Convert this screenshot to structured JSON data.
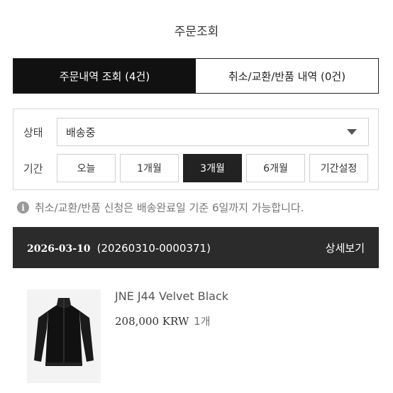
{
  "header": {
    "title": "주문조회"
  },
  "tabs": [
    {
      "label": "주문내역 조회 (4건)",
      "active": true
    },
    {
      "label": "취소/교환/반품 내역 (0건)",
      "active": false
    }
  ],
  "filter": {
    "status_label": "상태",
    "status_value": "배송중",
    "period_label": "기간",
    "periods": [
      "오늘",
      "1개월",
      "3개월",
      "6개월",
      "기간설정"
    ],
    "active_period": "3개월"
  },
  "notice": {
    "icon": "info-icon",
    "text": "취소/교환/반품 신청은 배송완료일 기준 6일까지 가능합니다."
  },
  "order": {
    "date": "2026-03-10",
    "number": "(20260310-0000371)",
    "detail_label": "상세보기"
  },
  "product": {
    "name": "JNE J44 Velvet Black",
    "price": "208,000 KRW",
    "quantity": "1개",
    "thumbnail_icon": "jacket-icon"
  },
  "colors": {
    "active_tab_bg": "#111111",
    "order_bar_bg": "#2b2b2b",
    "border": "#cfcfcf"
  }
}
